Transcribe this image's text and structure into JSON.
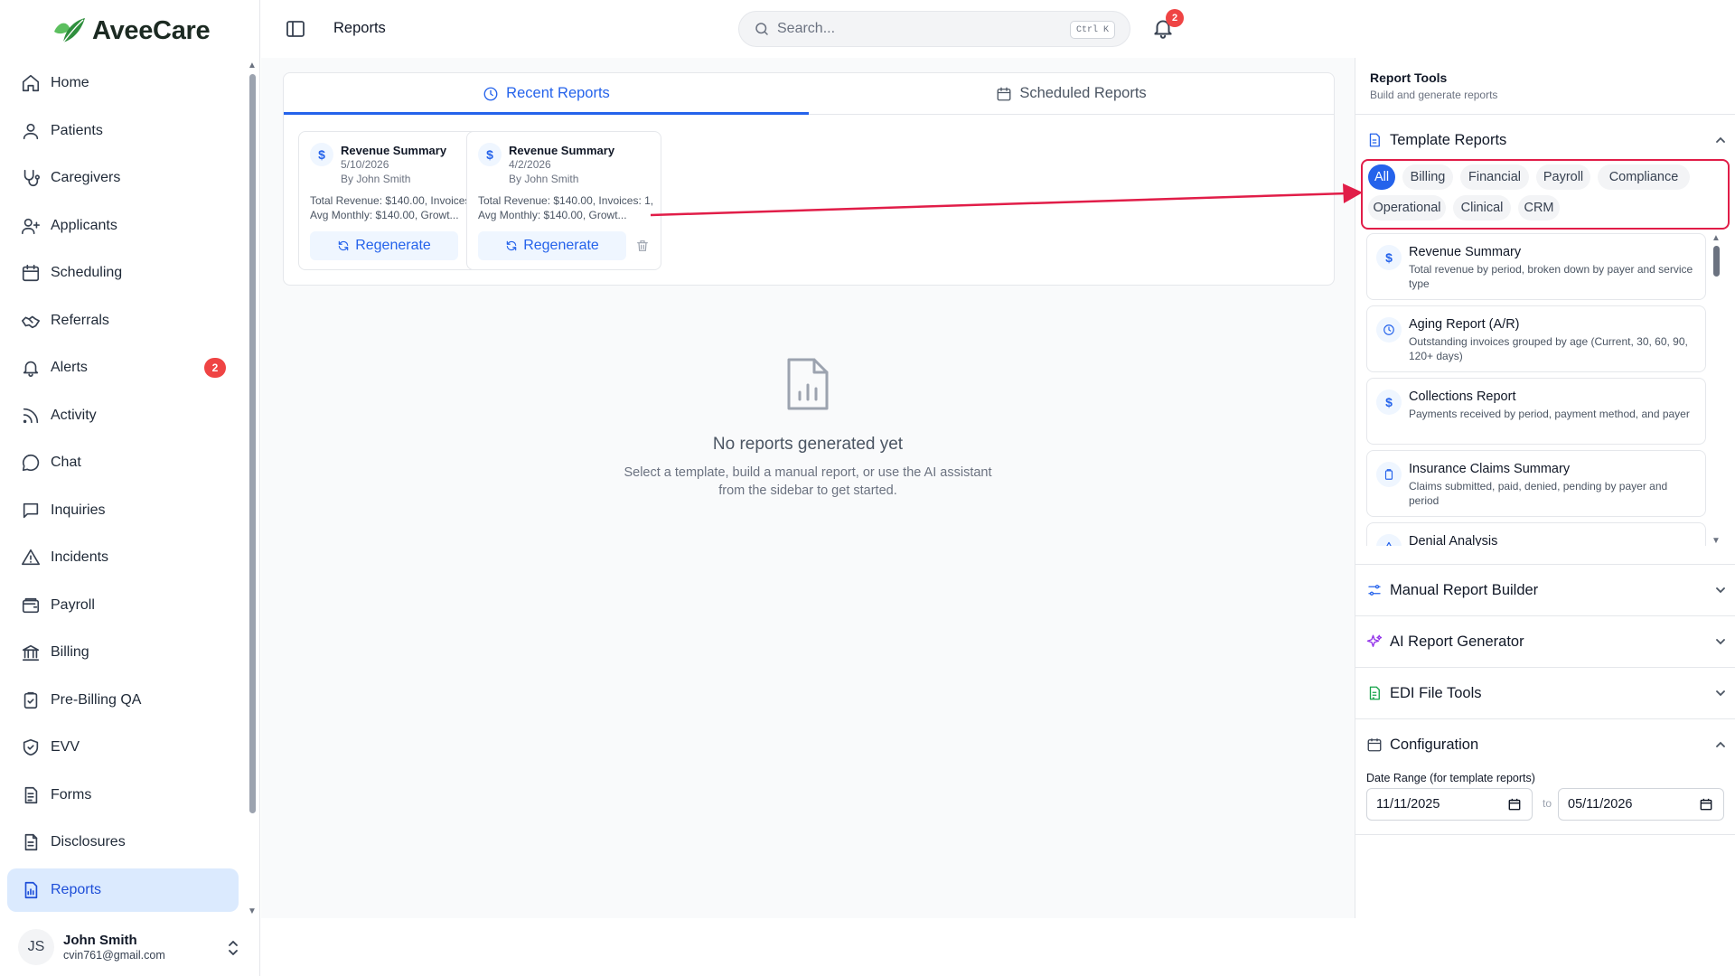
{
  "app": {
    "name": "AveeCare",
    "page_title": "Reports"
  },
  "search": {
    "placeholder": "Search...",
    "shortcut": "Ctrl K"
  },
  "notifications": {
    "count": "2"
  },
  "sidebar": {
    "items": [
      {
        "label": "Home",
        "icon": "home-icon"
      },
      {
        "label": "Patients",
        "icon": "user-icon"
      },
      {
        "label": "Caregivers",
        "icon": "stethoscope-icon"
      },
      {
        "label": "Applicants",
        "icon": "user-plus-icon"
      },
      {
        "label": "Scheduling",
        "icon": "calendar-icon"
      },
      {
        "label": "Referrals",
        "icon": "handshake-icon"
      },
      {
        "label": "Alerts",
        "icon": "bell-icon",
        "badge": "2"
      },
      {
        "label": "Activity",
        "icon": "rss-icon"
      },
      {
        "label": "Chat",
        "icon": "chat-bubble-icon"
      },
      {
        "label": "Inquiries",
        "icon": "message-square-icon"
      },
      {
        "label": "Incidents",
        "icon": "warning-triangle-icon"
      },
      {
        "label": "Payroll",
        "icon": "wallet-icon"
      },
      {
        "label": "Billing",
        "icon": "bank-icon"
      },
      {
        "label": "Pre-Billing QA",
        "icon": "clipboard-check-icon"
      },
      {
        "label": "EVV",
        "icon": "shield-check-icon"
      },
      {
        "label": "Forms",
        "icon": "form-icon"
      },
      {
        "label": "Disclosures",
        "icon": "document-icon"
      },
      {
        "label": "Reports",
        "icon": "report-icon",
        "active": true
      }
    ],
    "user": {
      "initials": "JS",
      "name": "John Smith",
      "email": "cvin761@gmail.com"
    }
  },
  "main": {
    "tabs": [
      {
        "label": "Recent Reports",
        "active": true
      },
      {
        "label": "Scheduled Reports",
        "active": false
      }
    ],
    "recent_reports": [
      {
        "title": "Revenue Summary",
        "date": "5/10/2026",
        "author": "By John Smith",
        "description": "Total Revenue: $140.00, Invoices: 1, Avg Monthly: $140.00, Growt...",
        "action": "Regenerate"
      },
      {
        "title": "Revenue Summary",
        "date": "4/2/2026",
        "author": "By John Smith",
        "description": "Total Revenue: $140.00, Invoices: 1, Avg Monthly: $140.00, Growt...",
        "action": "Regenerate"
      }
    ],
    "empty_state": {
      "title": "No reports generated yet",
      "line1": "Select a template, build a manual report, or use the AI assistant",
      "line2": "from the sidebar to get started."
    }
  },
  "report_tools": {
    "title": "Report Tools",
    "subtitle": "Build and generate reports",
    "template_reports": {
      "label": "Template Reports",
      "filters": [
        "All",
        "Billing",
        "Financial",
        "Payroll",
        "Compliance",
        "Operational",
        "Clinical",
        "CRM"
      ],
      "active_filter": "All",
      "templates": [
        {
          "name": "Revenue Summary",
          "description": "Total revenue by period, broken down by payer and service type",
          "icon": "dollar-icon"
        },
        {
          "name": "Aging Report (A/R)",
          "description": "Outstanding invoices grouped by age (Current, 30, 60, 90, 120+ days)",
          "icon": "clock-icon"
        },
        {
          "name": "Collections Report",
          "description": "Payments received by period, payment method, and payer",
          "icon": "dollar-icon"
        },
        {
          "name": "Insurance Claims Summary",
          "description": "Claims submitted, paid, denied, pending by payer and period",
          "icon": "clipboard-icon"
        },
        {
          "name": "Denial Analysis",
          "description": "",
          "icon": "warning-triangle-icon"
        }
      ]
    },
    "sections": [
      {
        "label": "Manual Report Builder",
        "icon": "sliders-icon"
      },
      {
        "label": "AI Report Generator",
        "icon": "sparkles-icon"
      },
      {
        "label": "EDI File Tools",
        "icon": "file-code-icon"
      }
    ],
    "configuration": {
      "label": "Configuration",
      "date_range_label": "Date Range (for template reports)",
      "from": "11/11/2025",
      "to_label": "to",
      "to": "05/11/2026"
    }
  },
  "colors": {
    "brand_green": "#3ea64a",
    "accent_blue": "#2563eb",
    "active_nav_bg": "#dbeafe",
    "badge_red": "#ef4444",
    "annotation_red": "#e11d48"
  }
}
